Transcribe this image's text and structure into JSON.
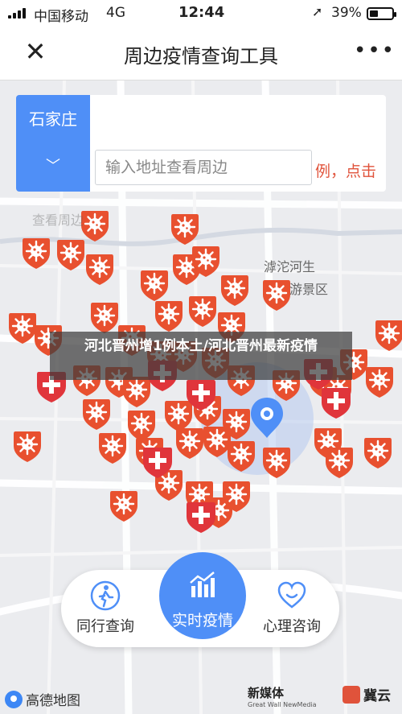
{
  "status_bar": {
    "carrier": "中国移动",
    "network": "4G",
    "time": "12:44",
    "battery": "39%",
    "battery_level": 0.39
  },
  "header": {
    "title": "周边疫情查询工具",
    "more_label": "•••"
  },
  "search": {
    "city": "石家庄",
    "address_placeholder": "输入地址查看周边",
    "hint": "例，点击"
  },
  "map": {
    "caption": "河北晋州增1例本土/河北晋州最新疫情",
    "poi_label_1": "滹沱河生",
    "poi_label_2": "游景区",
    "faded_label": "查看周边"
  },
  "bottom_nav": {
    "left_label": "同行查询",
    "center_label": "实时疫情",
    "right_label": "心理咨询"
  },
  "footer": {
    "amap_logo": "高德地图",
    "greatwall_logo": "新媒体",
    "greatwall_sub": "Great Wall NewMedia",
    "jiyun_logo": "冀云"
  },
  "colors": {
    "accent": "#4f8ff7",
    "virus": "#e8502f",
    "hospital": "#e0353b"
  }
}
